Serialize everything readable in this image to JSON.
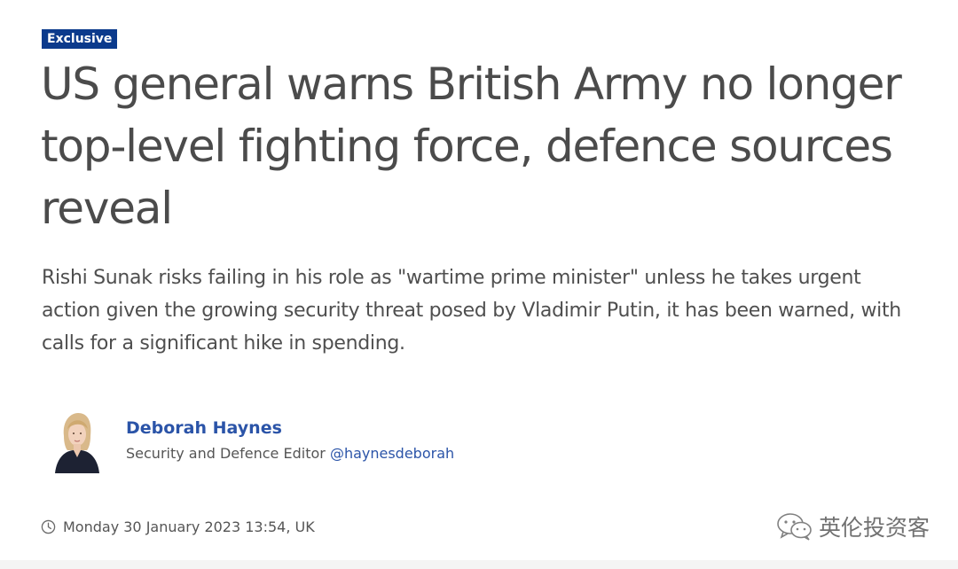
{
  "article": {
    "badge": "Exclusive",
    "headline": "US general warns British Army no longer top-level fighting force, defence sources reveal",
    "summary": "Rishi Sunak risks failing in his role as \"wartime prime minister\" unless he takes urgent action given the growing security threat posed by Vladimir Putin, it has been warned, with calls for a significant hike in spending."
  },
  "author": {
    "name": "Deborah Haynes",
    "role": "Security and Defence Editor",
    "handle": "@haynesdeborah",
    "avatar_icon": "author-photo"
  },
  "meta": {
    "timestamp": "Monday 30 January 2023 13:54, UK",
    "clock_icon": "clock-icon"
  },
  "watermark": {
    "text": "英伦投资客",
    "icon": "wechat-icon"
  },
  "colors": {
    "badge_bg": "#0b3a8c",
    "link": "#2b54a8",
    "headline_text": "#4b4b4b"
  }
}
